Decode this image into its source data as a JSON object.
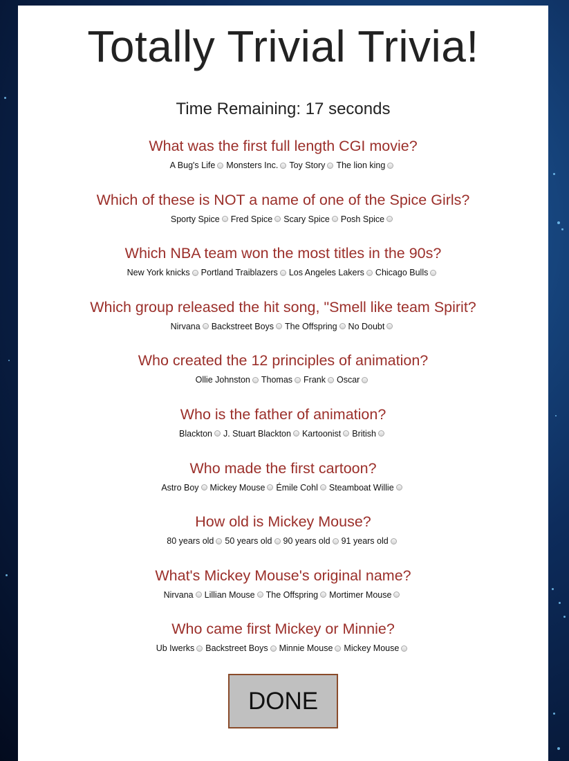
{
  "title": "Totally Trivial Trivia!",
  "timer": "Time Remaining: 17 seconds",
  "questions": [
    {
      "text": "What was the first full length CGI movie?",
      "options": [
        "A Bug's Life",
        "Monsters Inc.",
        "Toy Story",
        "The lion king"
      ]
    },
    {
      "text": "Which of these is NOT a name of one of the Spice Girls?",
      "options": [
        "Sporty Spice",
        "Fred Spice",
        "Scary Spice",
        "Posh Spice"
      ]
    },
    {
      "text": "Which NBA team won the most titles in the 90s?",
      "options": [
        "New York knicks",
        "Portland Traiblazers",
        "Los Angeles Lakers",
        "Chicago Bulls"
      ]
    },
    {
      "text": "Which group released the hit song, \"Smell like team Spirit?",
      "options": [
        "Nirvana",
        "Backstreet Boys",
        "The Offspring",
        "No Doubt"
      ]
    },
    {
      "text": "Who created the 12 principles of animation?",
      "options": [
        "Ollie Johnston",
        "Thomas",
        "Frank",
        "Oscar"
      ]
    },
    {
      "text": "Who is the father of animation?",
      "options": [
        "Blackton",
        "J. Stuart Blackton",
        "Kartoonist",
        "British"
      ]
    },
    {
      "text": "Who made the first cartoon?",
      "options": [
        "Astro Boy",
        "Mickey Mouse",
        "Émile Cohl",
        "Steamboat Willie"
      ]
    },
    {
      "text": "How old is Mickey Mouse?",
      "options": [
        "80 years old",
        "50 years old",
        "90 years old",
        "91 years old"
      ]
    },
    {
      "text": "What's Mickey Mouse's original name?",
      "options": [
        "Nirvana",
        "Lillian Mouse",
        "The Offspring",
        "Mortimer Mouse"
      ]
    },
    {
      "text": "Who came first Mickey or Minnie?",
      "options": [
        "Ub Iwerks",
        "Backstreet Boys",
        "Minnie Mouse",
        "Mickey Mouse"
      ]
    }
  ],
  "done_label": "DONE",
  "colors": {
    "question": "#9b2f2a",
    "button_bg": "#c0c0c0",
    "button_border": "#8a4b2a"
  }
}
